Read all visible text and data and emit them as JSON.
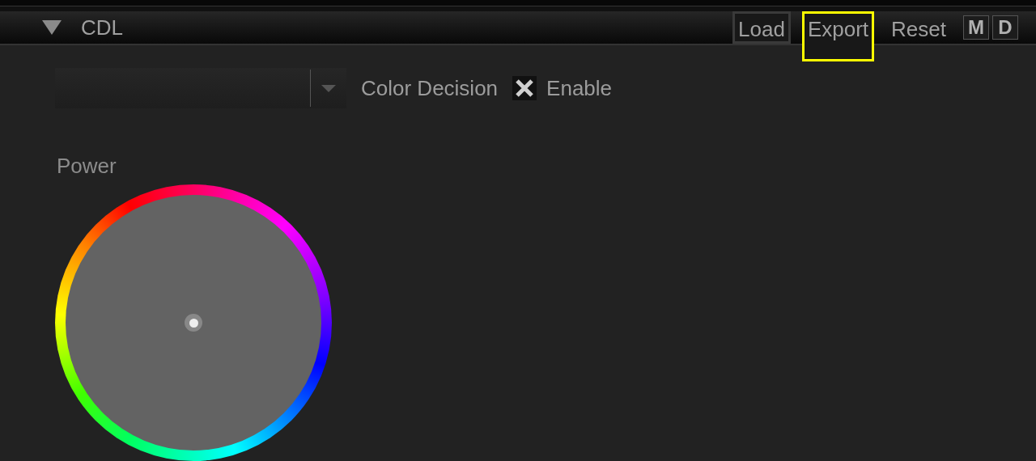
{
  "section": {
    "title": "CDL",
    "expanded": true
  },
  "buttons": [
    {
      "label": "Load",
      "highlighted": false
    },
    {
      "label": "Export",
      "highlighted": true
    },
    {
      "label": "Reset",
      "highlighted": false
    }
  ],
  "mode_buttons": [
    "M",
    "D"
  ],
  "color_decision": {
    "label": "Color Decision",
    "enable": {
      "label": "Enable",
      "checked": true
    }
  },
  "power": {
    "label": "Power"
  }
}
